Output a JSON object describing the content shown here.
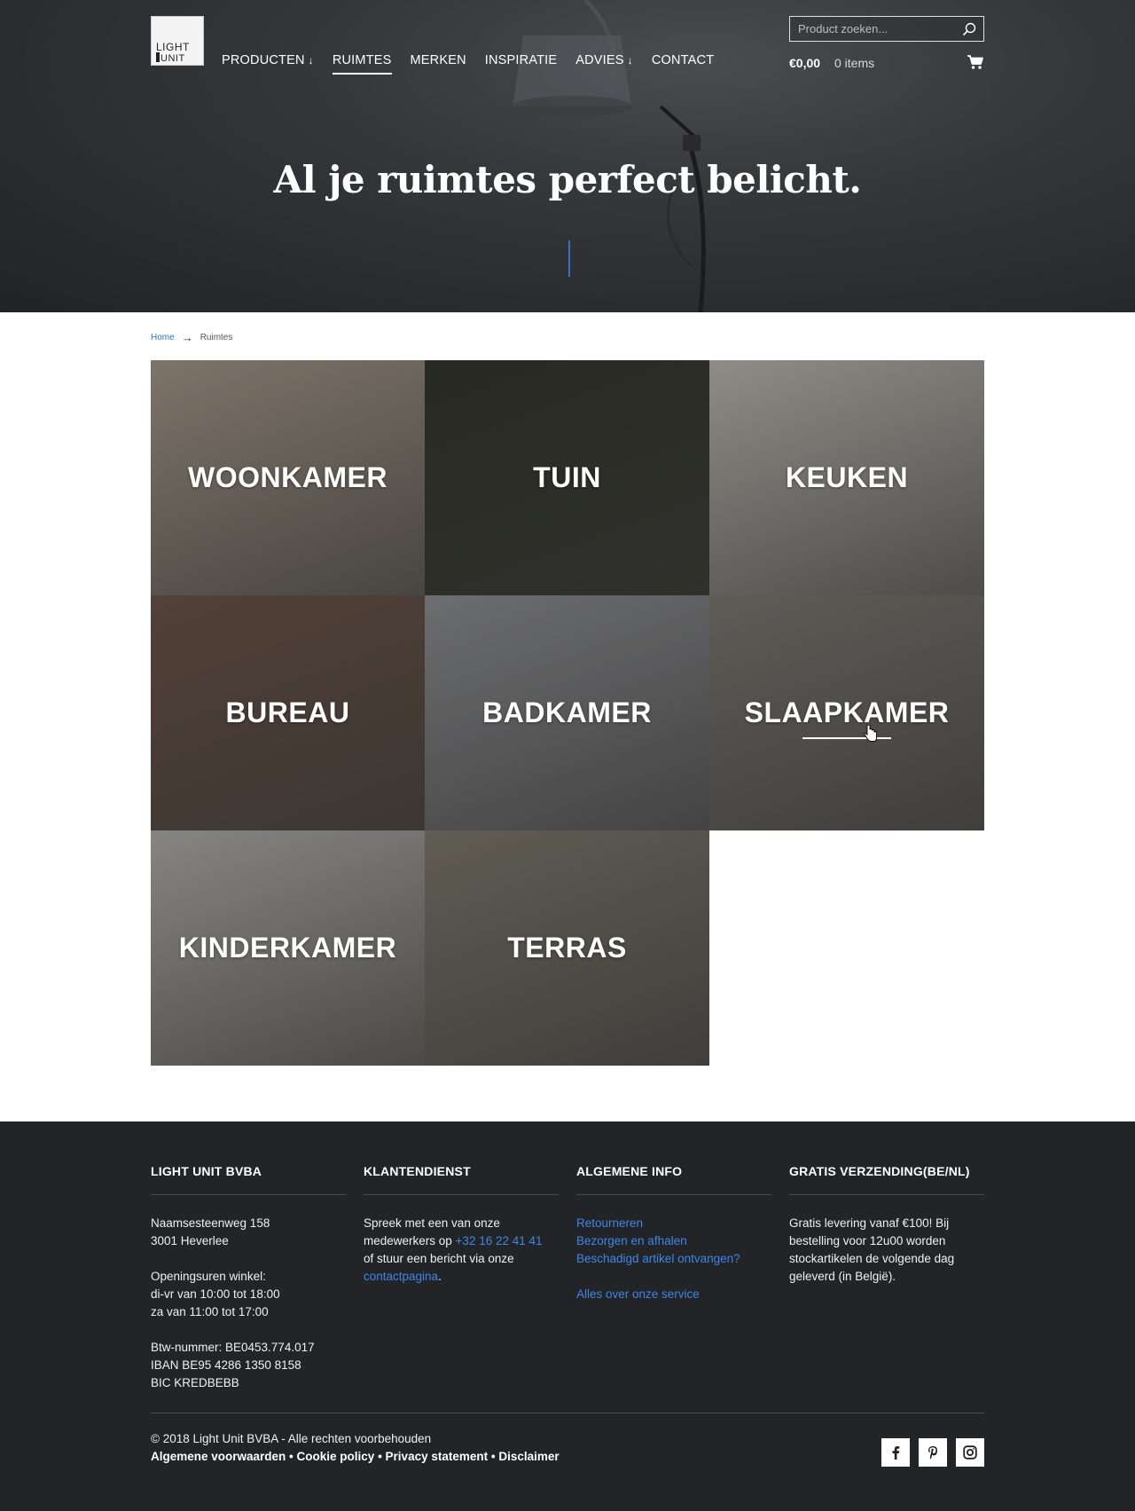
{
  "header": {
    "logo_alt": "LIGHT UNIT",
    "nav": [
      {
        "label": "PRODUCTEN",
        "dropdown": true
      },
      {
        "label": "RUIMTES",
        "active": true
      },
      {
        "label": "MERKEN"
      },
      {
        "label": "INSPIRATIE"
      },
      {
        "label": "ADVIES",
        "dropdown": true
      },
      {
        "label": "CONTACT"
      }
    ],
    "search_placeholder": "Product zoeken...",
    "cart_total": "€0,00",
    "cart_items": "0 items",
    "dropdown_glyph": "↓"
  },
  "hero": {
    "title": "Al je ruimtes perfect belicht."
  },
  "breadcrumb": {
    "home": "Home",
    "arrow": "→",
    "current": "Ruimtes"
  },
  "rooms": [
    {
      "label": "WOONKAMER",
      "color": "#8f8578"
    },
    {
      "label": "TUIN",
      "color": "#2e3126"
    },
    {
      "label": "KEUKEN",
      "color": "#a4a09a"
    },
    {
      "label": "BUREAU",
      "color": "#5e4b40"
    },
    {
      "label": "BADKAMER",
      "color": "#7c7d80"
    },
    {
      "label": "SLAAPKAMER",
      "color": "#6d6964"
    },
    {
      "label": "KINDERKAMER",
      "color": "#9a9894"
    },
    {
      "label": "TERRAS",
      "color": "#6e6a60"
    }
  ],
  "footer": {
    "col1": {
      "title": "LIGHT UNIT BVBA",
      "address1": "Naamsesteenweg 158",
      "address2": "3001 Heverlee",
      "hours_title": "Openingsuren winkel:",
      "hours1": "di-vr van 10:00 tot 18:00",
      "hours2": "za van 11:00 tot 17:00",
      "vat": "Btw-nummer: BE0453.774.017",
      "iban": "IBAN BE95 4286 1350 8158",
      "bic": "BIC KREDBEBB"
    },
    "col2": {
      "title": "KLANTENDIENST",
      "text1": "Spreek met een van onze",
      "text2": "medewerkers op ",
      "phone": "+32 16 22 41 41",
      "text3": "of stuur een bericht via onze",
      "contact_link": "contactpagina",
      "period": "."
    },
    "col3": {
      "title": "ALGEMENE INFO",
      "links": [
        "Retourneren",
        "Bezorgen en afhalen",
        "Beschadigd artikel ontvangen?"
      ],
      "service_link": "Alles over onze service"
    },
    "col4": {
      "title": "GRATIS VERZENDING(BE/NL)",
      "line1": "Gratis levering vanaf €100! Bij",
      "line2": "bestelling voor 12u00 worden",
      "line3": "stockartikelen de volgende dag",
      "line4": "geleverd (in België)."
    },
    "copyright": "© 2018 Light Unit BVBA - Alle rechten voorbehouden",
    "legal": [
      "Algemene voorwaarden",
      "Cookie policy",
      "Privacy statement",
      "Disclaimer"
    ],
    "legal_sep": " • ",
    "social": [
      "facebook-icon",
      "pinterest-icon",
      "instagram-icon"
    ]
  },
  "colors": {
    "accent": "#2f74d0",
    "link": "#3d86e6",
    "footer_bg": "#232427"
  }
}
